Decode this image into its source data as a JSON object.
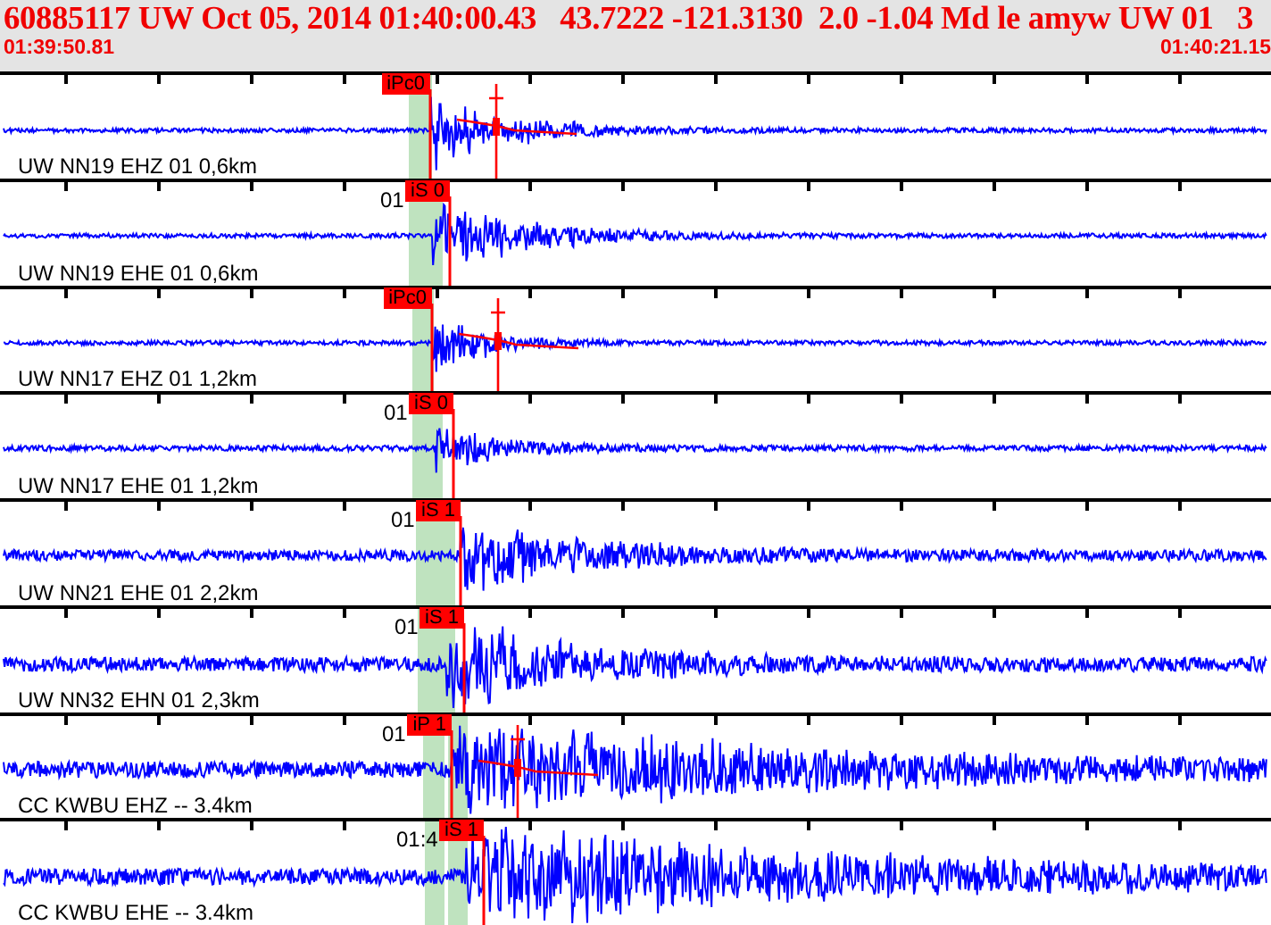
{
  "header": {
    "title": "60885117 UW Oct 05, 2014 01:40:00.43   43.7222 -121.3130  2.0 -1.04 Md le amyw UW 01   3",
    "start_time": "01:39:50.81",
    "end_time": "01:40:21.15"
  },
  "traces": [
    {
      "label": "UW NN19 EHZ 01 0,6km",
      "pick": "iPc0",
      "coda_fit": true
    },
    {
      "label": "UW NN19 EHE 01 0,6km",
      "pick": "iS 0",
      "time_label": "01",
      "coda_fit": false
    },
    {
      "label": "UW NN17 EHZ 01 1,2km",
      "pick": "iPc0",
      "coda_fit": true
    },
    {
      "label": "UW NN17 EHE 01 1,2km",
      "pick": "iS 0",
      "time_label": "01",
      "coda_fit": false
    },
    {
      "label": "UW NN21 EHE 01 2,2km",
      "pick": "iS 1",
      "time_label": "01",
      "coda_fit": false
    },
    {
      "label": "UW NN32 EHN 01 2,3km",
      "pick": "iS 1",
      "time_label": "01",
      "coda_fit": false
    },
    {
      "label": "CC KWBU EHZ -- 3.4km",
      "pick": "iP 1",
      "time_label": "01",
      "coda_fit": true
    },
    {
      "label": "CC KWBU EHE -- 3.4km",
      "pick": "iS 1",
      "time_label": "01:4",
      "coda_fit": false
    }
  ]
}
